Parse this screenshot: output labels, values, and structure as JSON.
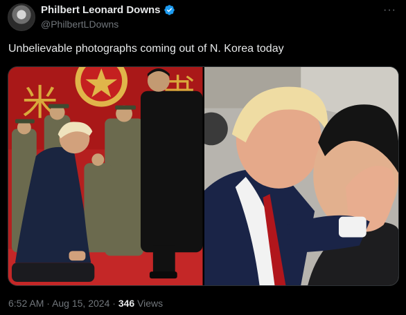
{
  "author": {
    "display_name": "Philbert Leonard Downs",
    "handle": "@PhilbertLDowns",
    "verified": true,
    "avatar_icon": "avatar-icon"
  },
  "tweet": {
    "text": "Unbelievable photographs coming out of N. Korea today",
    "more_icon": "more-horizontal-icon"
  },
  "media": {
    "photos": [
      {
        "label": "photo-1"
      },
      {
        "label": "photo-2"
      }
    ]
  },
  "meta": {
    "time": "6:52 AM",
    "sep1": "·",
    "date": "Aug 15, 2024",
    "sep2": "·",
    "views_count": "346",
    "views_label": "Views"
  },
  "colors": {
    "background": "#000000",
    "text": "#e7e9ea",
    "secondary": "#71767b",
    "verified": "#1d9bf0",
    "border": "#2f3336"
  }
}
